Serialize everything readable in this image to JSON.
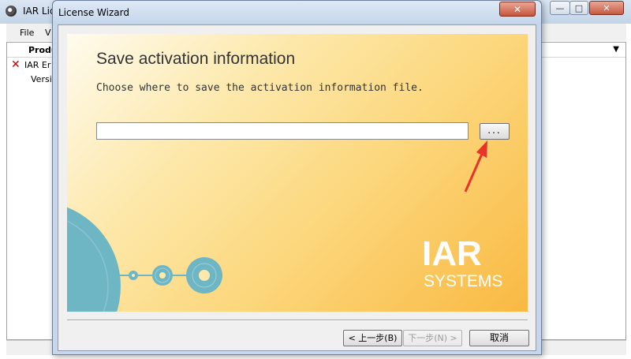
{
  "background_window": {
    "title": "IAR Lic",
    "caption_buttons": {
      "minimize": "—",
      "maximize": "□",
      "close": "✕"
    },
    "menu": [
      "File",
      "V"
    ],
    "list": {
      "column_header": "Produ",
      "rows": [
        {
          "text": "IAR Er",
          "status_icon": "x-error-icon"
        },
        {
          "text": "Versi"
        }
      ],
      "dropdown_glyph": "▼"
    }
  },
  "dialog": {
    "title": "License Wizard",
    "close_glyph": "✕",
    "heading": "Save activation information",
    "instruction": "Choose where to save the activation information file.",
    "path_input": {
      "value": "",
      "placeholder": ""
    },
    "browse_label": "...",
    "logo": {
      "line1": "IAR",
      "line2": "SYSTEMS"
    },
    "buttons": {
      "back": "< 上一步(B)",
      "next": "下一步(N) >",
      "cancel": "取消"
    },
    "colors": {
      "accent_arrow": "#e8322a",
      "banner_start": "#fffbee",
      "banner_end": "#f9b942",
      "disc": "#6fb6c4"
    }
  }
}
